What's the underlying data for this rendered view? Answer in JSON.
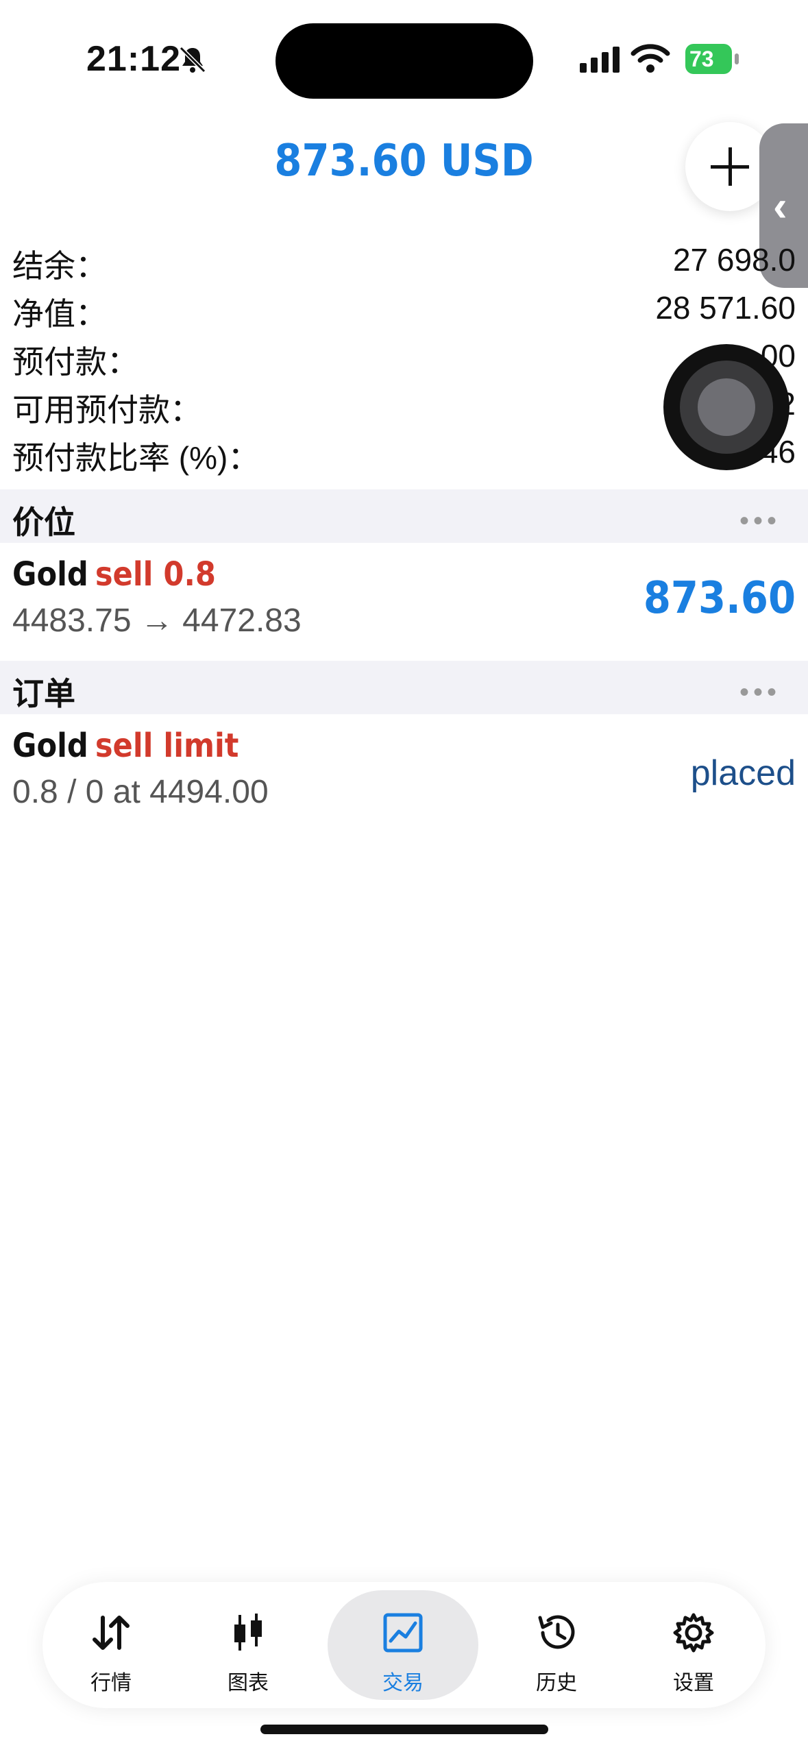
{
  "status_bar": {
    "time": "21:12",
    "battery": "73"
  },
  "header": {
    "title": "873.60 USD"
  },
  "summary": [
    {
      "label": "结余：",
      "value": "27 698.0"
    },
    {
      "label": "净值：",
      "value": "28 571.60"
    },
    {
      "label": "预付款：",
      "value": "00"
    },
    {
      "label": "可用预付款：",
      "value": "2"
    },
    {
      "label": "预付款比率 (%)：",
      "value": "3 46"
    }
  ],
  "positions": {
    "header": "价位",
    "items": [
      {
        "symbol": "Gold",
        "action": "sell 0.8",
        "prices": "4483.75 → 4472.83",
        "profit": "873.60"
      }
    ]
  },
  "orders": {
    "header": "订单",
    "items": [
      {
        "symbol": "Gold",
        "action": "sell limit",
        "details": "0.8 / 0 at 4494.00",
        "status": "placed"
      }
    ]
  },
  "tabbar": {
    "items": [
      {
        "label": "行情",
        "icon": "arrows-updown-icon"
      },
      {
        "label": "图表",
        "icon": "candlestick-icon"
      },
      {
        "label": "交易",
        "icon": "trade-chart-icon",
        "active": true
      },
      {
        "label": "历史",
        "icon": "history-icon"
      },
      {
        "label": "设置",
        "icon": "gear-icon"
      }
    ]
  },
  "colors": {
    "accent": "#1a7fe0",
    "sell": "#d23a2c",
    "placed": "#1d4f8a"
  }
}
